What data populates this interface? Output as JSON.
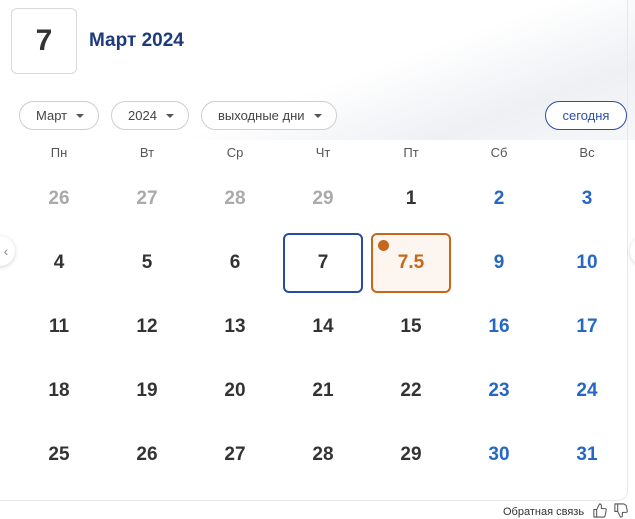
{
  "header": {
    "day": "7",
    "month_year": "Март 2024"
  },
  "filters": {
    "month": "Март",
    "year": "2024",
    "mode": "выходные дни",
    "today_label": "сегодня"
  },
  "weekdays": [
    "Пн",
    "Вт",
    "Ср",
    "Чт",
    "Пт",
    "Сб",
    "Вс"
  ],
  "weeks": [
    [
      {
        "label": "26",
        "kind": "muted"
      },
      {
        "label": "27",
        "kind": "muted"
      },
      {
        "label": "28",
        "kind": "muted"
      },
      {
        "label": "29",
        "kind": "muted"
      },
      {
        "label": "1",
        "kind": "normal"
      },
      {
        "label": "2",
        "kind": "weekend"
      },
      {
        "label": "3",
        "kind": "weekend"
      }
    ],
    [
      {
        "label": "4",
        "kind": "normal"
      },
      {
        "label": "5",
        "kind": "normal"
      },
      {
        "label": "6",
        "kind": "normal"
      },
      {
        "label": "7",
        "kind": "today"
      },
      {
        "label": "7.5",
        "kind": "short"
      },
      {
        "label": "9",
        "kind": "weekend"
      },
      {
        "label": "10",
        "kind": "weekend"
      }
    ],
    [
      {
        "label": "11",
        "kind": "normal"
      },
      {
        "label": "12",
        "kind": "normal"
      },
      {
        "label": "13",
        "kind": "normal"
      },
      {
        "label": "14",
        "kind": "normal"
      },
      {
        "label": "15",
        "kind": "normal"
      },
      {
        "label": "16",
        "kind": "weekend"
      },
      {
        "label": "17",
        "kind": "weekend"
      }
    ],
    [
      {
        "label": "18",
        "kind": "normal"
      },
      {
        "label": "19",
        "kind": "normal"
      },
      {
        "label": "20",
        "kind": "normal"
      },
      {
        "label": "21",
        "kind": "normal"
      },
      {
        "label": "22",
        "kind": "normal"
      },
      {
        "label": "23",
        "kind": "weekend"
      },
      {
        "label": "24",
        "kind": "weekend"
      }
    ],
    [
      {
        "label": "25",
        "kind": "normal"
      },
      {
        "label": "26",
        "kind": "normal"
      },
      {
        "label": "27",
        "kind": "normal"
      },
      {
        "label": "28",
        "kind": "normal"
      },
      {
        "label": "29",
        "kind": "normal"
      },
      {
        "label": "30",
        "kind": "weekend"
      },
      {
        "label": "31",
        "kind": "weekend"
      }
    ]
  ],
  "feedback": {
    "label": "Обратная связь"
  },
  "icons": {
    "prev": "chevron-left-icon",
    "next": "chevron-right-icon",
    "like": "thumbs-up-icon",
    "dislike": "thumbs-down-icon",
    "short_day_marker": "dot-icon"
  },
  "colors": {
    "title": "#1d3b7a",
    "weekend": "#2567c2",
    "today_border": "#2a4aa3",
    "short_day": "#c8661a",
    "muted": "#aaaaaa"
  }
}
